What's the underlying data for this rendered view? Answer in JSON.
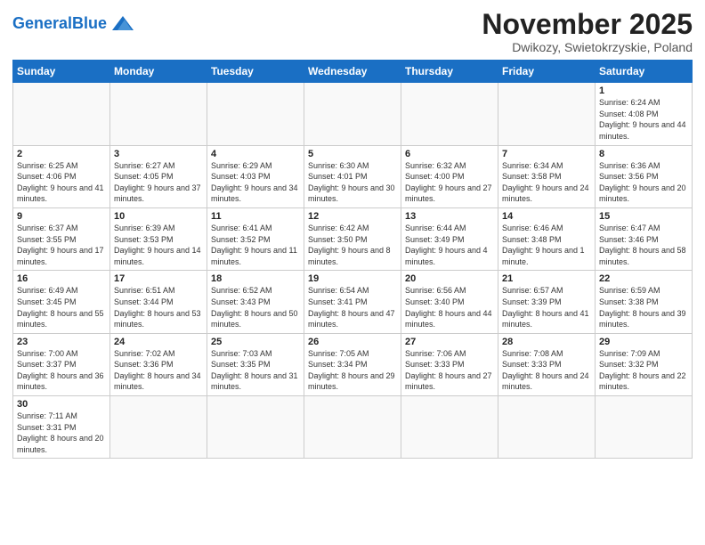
{
  "header": {
    "logo_general": "General",
    "logo_blue": "Blue",
    "month_title": "November 2025",
    "location": "Dwikozy, Swietokrzyskie, Poland"
  },
  "days_of_week": [
    "Sunday",
    "Monday",
    "Tuesday",
    "Wednesday",
    "Thursday",
    "Friday",
    "Saturday"
  ],
  "weeks": [
    [
      {
        "day": "",
        "info": ""
      },
      {
        "day": "",
        "info": ""
      },
      {
        "day": "",
        "info": ""
      },
      {
        "day": "",
        "info": ""
      },
      {
        "day": "",
        "info": ""
      },
      {
        "day": "",
        "info": ""
      },
      {
        "day": "1",
        "info": "Sunrise: 6:24 AM\nSunset: 4:08 PM\nDaylight: 9 hours and 44 minutes."
      }
    ],
    [
      {
        "day": "2",
        "info": "Sunrise: 6:25 AM\nSunset: 4:06 PM\nDaylight: 9 hours and 41 minutes."
      },
      {
        "day": "3",
        "info": "Sunrise: 6:27 AM\nSunset: 4:05 PM\nDaylight: 9 hours and 37 minutes."
      },
      {
        "day": "4",
        "info": "Sunrise: 6:29 AM\nSunset: 4:03 PM\nDaylight: 9 hours and 34 minutes."
      },
      {
        "day": "5",
        "info": "Sunrise: 6:30 AM\nSunset: 4:01 PM\nDaylight: 9 hours and 30 minutes."
      },
      {
        "day": "6",
        "info": "Sunrise: 6:32 AM\nSunset: 4:00 PM\nDaylight: 9 hours and 27 minutes."
      },
      {
        "day": "7",
        "info": "Sunrise: 6:34 AM\nSunset: 3:58 PM\nDaylight: 9 hours and 24 minutes."
      },
      {
        "day": "8",
        "info": "Sunrise: 6:36 AM\nSunset: 3:56 PM\nDaylight: 9 hours and 20 minutes."
      }
    ],
    [
      {
        "day": "9",
        "info": "Sunrise: 6:37 AM\nSunset: 3:55 PM\nDaylight: 9 hours and 17 minutes."
      },
      {
        "day": "10",
        "info": "Sunrise: 6:39 AM\nSunset: 3:53 PM\nDaylight: 9 hours and 14 minutes."
      },
      {
        "day": "11",
        "info": "Sunrise: 6:41 AM\nSunset: 3:52 PM\nDaylight: 9 hours and 11 minutes."
      },
      {
        "day": "12",
        "info": "Sunrise: 6:42 AM\nSunset: 3:50 PM\nDaylight: 9 hours and 8 minutes."
      },
      {
        "day": "13",
        "info": "Sunrise: 6:44 AM\nSunset: 3:49 PM\nDaylight: 9 hours and 4 minutes."
      },
      {
        "day": "14",
        "info": "Sunrise: 6:46 AM\nSunset: 3:48 PM\nDaylight: 9 hours and 1 minute."
      },
      {
        "day": "15",
        "info": "Sunrise: 6:47 AM\nSunset: 3:46 PM\nDaylight: 8 hours and 58 minutes."
      }
    ],
    [
      {
        "day": "16",
        "info": "Sunrise: 6:49 AM\nSunset: 3:45 PM\nDaylight: 8 hours and 55 minutes."
      },
      {
        "day": "17",
        "info": "Sunrise: 6:51 AM\nSunset: 3:44 PM\nDaylight: 8 hours and 53 minutes."
      },
      {
        "day": "18",
        "info": "Sunrise: 6:52 AM\nSunset: 3:43 PM\nDaylight: 8 hours and 50 minutes."
      },
      {
        "day": "19",
        "info": "Sunrise: 6:54 AM\nSunset: 3:41 PM\nDaylight: 8 hours and 47 minutes."
      },
      {
        "day": "20",
        "info": "Sunrise: 6:56 AM\nSunset: 3:40 PM\nDaylight: 8 hours and 44 minutes."
      },
      {
        "day": "21",
        "info": "Sunrise: 6:57 AM\nSunset: 3:39 PM\nDaylight: 8 hours and 41 minutes."
      },
      {
        "day": "22",
        "info": "Sunrise: 6:59 AM\nSunset: 3:38 PM\nDaylight: 8 hours and 39 minutes."
      }
    ],
    [
      {
        "day": "23",
        "info": "Sunrise: 7:00 AM\nSunset: 3:37 PM\nDaylight: 8 hours and 36 minutes."
      },
      {
        "day": "24",
        "info": "Sunrise: 7:02 AM\nSunset: 3:36 PM\nDaylight: 8 hours and 34 minutes."
      },
      {
        "day": "25",
        "info": "Sunrise: 7:03 AM\nSunset: 3:35 PM\nDaylight: 8 hours and 31 minutes."
      },
      {
        "day": "26",
        "info": "Sunrise: 7:05 AM\nSunset: 3:34 PM\nDaylight: 8 hours and 29 minutes."
      },
      {
        "day": "27",
        "info": "Sunrise: 7:06 AM\nSunset: 3:33 PM\nDaylight: 8 hours and 27 minutes."
      },
      {
        "day": "28",
        "info": "Sunrise: 7:08 AM\nSunset: 3:33 PM\nDaylight: 8 hours and 24 minutes."
      },
      {
        "day": "29",
        "info": "Sunrise: 7:09 AM\nSunset: 3:32 PM\nDaylight: 8 hours and 22 minutes."
      }
    ],
    [
      {
        "day": "30",
        "info": "Sunrise: 7:11 AM\nSunset: 3:31 PM\nDaylight: 8 hours and 20 minutes."
      },
      {
        "day": "",
        "info": ""
      },
      {
        "day": "",
        "info": ""
      },
      {
        "day": "",
        "info": ""
      },
      {
        "day": "",
        "info": ""
      },
      {
        "day": "",
        "info": ""
      },
      {
        "day": "",
        "info": ""
      }
    ]
  ]
}
